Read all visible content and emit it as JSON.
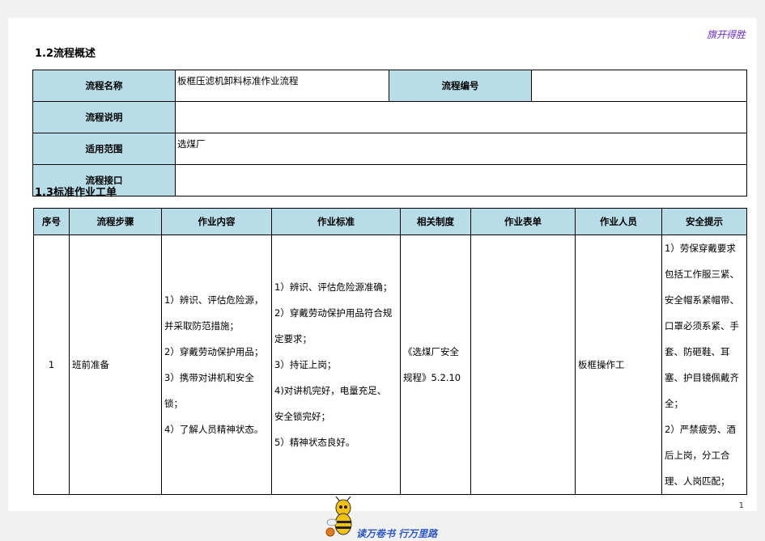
{
  "brand_top": "旗开得胜",
  "section_overview": {
    "title": "1.2流程概述"
  },
  "overview": {
    "rows": [
      {
        "label": "流程名称",
        "value": "板框压滤机卸料标准作业流程",
        "label2": "流程编号",
        "value2": ""
      },
      {
        "label": "流程说明",
        "value": ""
      },
      {
        "label": "适用范围",
        "value": "选煤厂"
      },
      {
        "label": "流程接口",
        "value": ""
      }
    ]
  },
  "section_worklist": {
    "title": "1.3标准作业工单"
  },
  "worklist": {
    "headers": [
      "序号",
      "流程步骤",
      "作业内容",
      "作业标准",
      "相关制度",
      "作业表单",
      "作业人员",
      "安全提示"
    ],
    "row": {
      "no": "1",
      "step": "班前准备",
      "content": [
        "1）辨识、评估危险源，",
        "并采取防范措施；",
        "2）穿戴劳动保护用品；",
        "3）携带对讲机和安全",
        "锁；",
        "4）了解人员精神状态。"
      ],
      "standard": [
        "1）辨识、评估危险源准确；",
        "2）穿戴劳动保护用品符合规",
        "定要求；",
        "3）持证上岗；",
        "4)对讲机完好，电量充足、",
        "安全锁完好；",
        "5）精神状态良好。"
      ],
      "policy": [
        "《选煤厂安全",
        "规程》5.2.10"
      ],
      "form": "",
      "personnel": "板框操作工",
      "safety": [
        "1）劳保穿戴要求",
        "包括工作服三紧、",
        "安全帽系紧帽带、",
        "口罩必须系紧、手",
        "套、防砸鞋、耳",
        "塞、护目镜佩戴齐",
        "全；",
        "2）严禁疲劳、酒",
        "后上岗，分工合",
        "理、人岗匹配；"
      ]
    }
  },
  "page_number": "1",
  "footer_brand": "读万卷书  行万里路"
}
